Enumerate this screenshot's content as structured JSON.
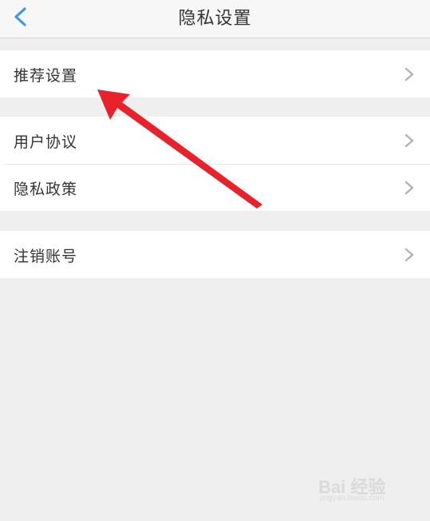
{
  "header": {
    "title": "隐私设置",
    "back_icon": "chevron-left-icon",
    "accent_color": "#3a9be0"
  },
  "groups": [
    {
      "items": [
        {
          "label": "推荐设置",
          "icon": "chevron-right-icon"
        }
      ]
    },
    {
      "items": [
        {
          "label": "用户协议",
          "icon": "chevron-right-icon"
        },
        {
          "label": "隐私政策",
          "icon": "chevron-right-icon"
        }
      ]
    },
    {
      "items": [
        {
          "label": "注销账号",
          "icon": "chevron-right-icon"
        }
      ]
    }
  ],
  "annotation": {
    "color": "#e8222b",
    "points_to": "推荐设置"
  },
  "watermark": {
    "logo": "Bai 经验",
    "sub": "jingyan.baidu.com"
  }
}
